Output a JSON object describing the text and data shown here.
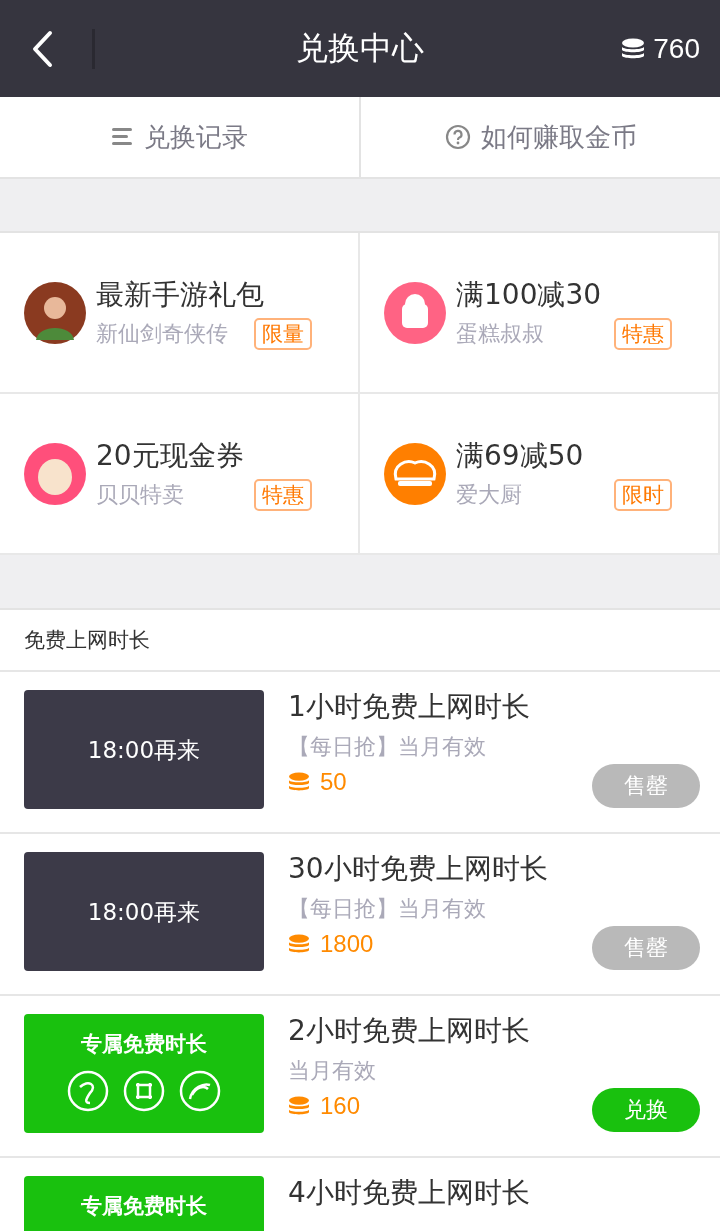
{
  "header": {
    "title": "兑换中心",
    "coins": "760"
  },
  "tabs": [
    {
      "label": "兑换记录",
      "kind": "list"
    },
    {
      "label": "如何赚取金币",
      "kind": "help"
    }
  ],
  "offers": [
    {
      "title": "最新手游礼包",
      "subtitle": "新仙剑奇侠传",
      "tag": "限量",
      "color": "#8a3a20"
    },
    {
      "title": "满100减30",
      "subtitle": "蛋糕叔叔",
      "tag": "特惠",
      "color": "#ff6384"
    },
    {
      "title": "20元现金券",
      "subtitle": "贝贝特卖",
      "tag": "特惠",
      "color": "#ff4f7b"
    },
    {
      "title": "满69减50",
      "subtitle": "爱大厨",
      "tag": "限时",
      "color": "#ff7f00"
    }
  ],
  "section_title": "免费上网时长",
  "items": [
    {
      "overlay": "18:00再来",
      "title": "1小时免费上网时长",
      "subtitle": "【每日抢】当月有效",
      "price": "50",
      "button": {
        "label": "售罄",
        "disabled": true
      }
    },
    {
      "overlay": "18:00再来",
      "title": "30小时免费上网时长",
      "subtitle": "【每日抢】当月有效",
      "price": "1800",
      "button": {
        "label": "售罄",
        "disabled": true
      }
    },
    {
      "banner_label": "专属免费时长",
      "title": "2小时免费上网时长",
      "subtitle": "当月有效",
      "price": "160",
      "button": {
        "label": "兑换",
        "disabled": false
      }
    },
    {
      "banner_label": "专属免费时长",
      "title": "4小时免费上网时长"
    }
  ]
}
